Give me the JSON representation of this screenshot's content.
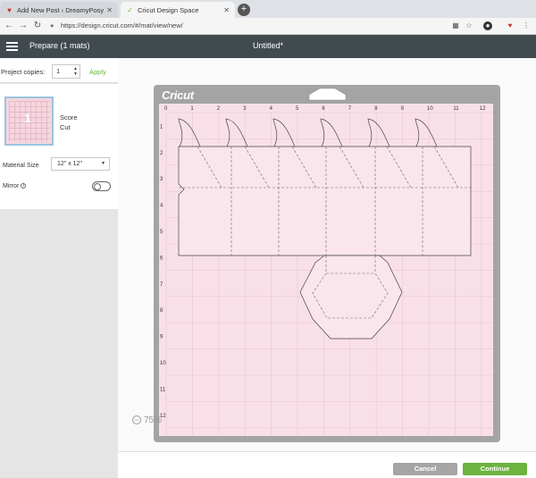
{
  "browser": {
    "tabs": [
      {
        "label": "Add New Post ‹ DreamyPosy.com",
        "active": false
      },
      {
        "label": "Cricut Design Space",
        "active": true
      }
    ],
    "url": "https://design.cricut.com/#/mat/view/new/"
  },
  "header": {
    "prepare_label": "Prepare (1 mats)",
    "project_title": "Untitled*"
  },
  "left": {
    "copies_label": "Project copies:",
    "copies_value": "1",
    "apply_label": "Apply",
    "mat_number": "1",
    "score_label": "Score",
    "cut_label": "Cut",
    "material_size_label": "Material Size",
    "material_size_value": "12\" x 12\"",
    "mirror_label": "Mirror",
    "mirror_on": false
  },
  "mat": {
    "logo": "Cricut",
    "top_ruler": [
      "0",
      "1",
      "2",
      "3",
      "4",
      "5",
      "6",
      "7",
      "8",
      "9",
      "10",
      "11",
      "12"
    ],
    "left_ruler": [
      "1",
      "2",
      "3",
      "4",
      "5",
      "6",
      "7",
      "8",
      "9",
      "10",
      "11",
      "12"
    ],
    "zoom": "75%"
  },
  "footer": {
    "cancel_label": "Cancel",
    "continue_label": "Continue"
  },
  "colors": {
    "accent": "#6cb33f",
    "header": "#414b4f",
    "mat_pink": "#f9e0e8",
    "mat_frame": "#a4a4a4"
  }
}
